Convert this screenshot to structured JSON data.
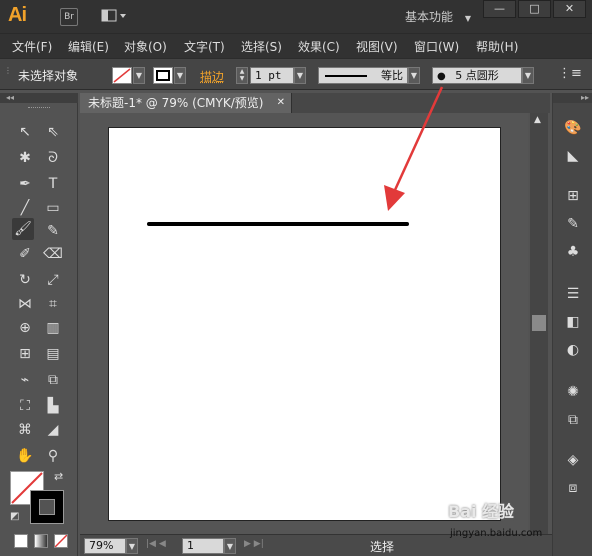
{
  "app": {
    "logo": "Ai",
    "br_label": "Br",
    "workspace": "基本功能"
  },
  "window_controls": {
    "minimize": "—",
    "maximize": "□",
    "close": "✕"
  },
  "menu": [
    "文件(F)",
    "编辑(E)",
    "对象(O)",
    "文字(T)",
    "选择(S)",
    "效果(C)",
    "视图(V)",
    "窗口(W)",
    "帮助(H)"
  ],
  "control_bar": {
    "selection_status": "未选择对象",
    "stroke_label": "描边",
    "stroke_weight": "1 pt",
    "stroke_profile": "等比",
    "brush": "5 点圆形"
  },
  "document": {
    "tab_title": "未标题-1* @ 79% (CMYK/预览)",
    "tab_close": "✕"
  },
  "status": {
    "zoom": "79%",
    "page": "1",
    "mode": "选择"
  },
  "watermark": {
    "text": "Bai 经验",
    "url": "jingyan.baidu.com"
  },
  "icons": [
    "selection-tool-icon",
    "direct-selection-tool-icon",
    "magic-wand-icon",
    "lasso-icon",
    "pen-tool-icon",
    "type-tool-icon",
    "line-segment-icon",
    "rectangle-icon",
    "paintbrush-icon",
    "pencil-icon",
    "blob-brush-icon",
    "eraser-icon",
    "rotate-icon",
    "scale-icon",
    "width-tool-icon",
    "free-transform-icon",
    "shape-builder-icon",
    "perspective-grid-icon",
    "mesh-icon",
    "gradient-icon",
    "eyedropper-icon",
    "blend-icon",
    "symbol-sprayer-icon",
    "column-graph-icon",
    "artboard-icon",
    "slice-icon",
    "hand-icon",
    "zoom-icon"
  ],
  "colors": {
    "accent": "#f1a22a",
    "arrow": "#e23a3a",
    "stroke_line": "#000000"
  }
}
